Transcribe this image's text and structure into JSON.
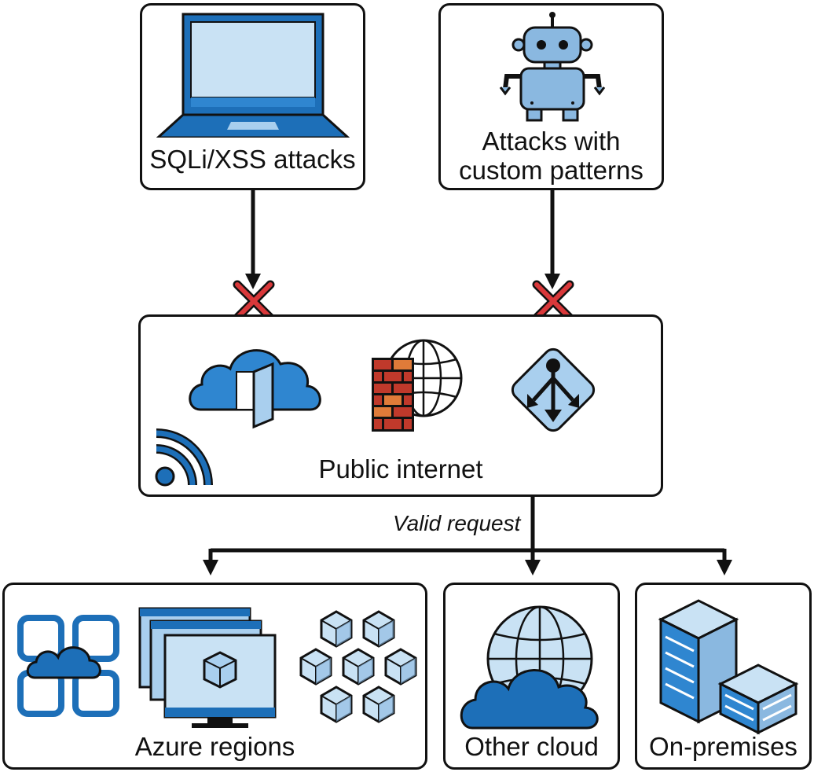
{
  "nodes": {
    "sqli": {
      "label": "SQLi/XSS attacks"
    },
    "custom": {
      "label_line1": "Attacks with",
      "label_line2": "custom patterns"
    },
    "internet": {
      "label": "Public internet"
    },
    "azure": {
      "label": "Azure regions"
    },
    "other_cloud": {
      "label": "Other cloud"
    },
    "on_prem": {
      "label": "On-premises"
    }
  },
  "edges": {
    "valid_request": "Valid request"
  },
  "colors": {
    "blue_dark": "#1d6fb8",
    "blue_mid": "#2f86d0",
    "blue_light": "#c9e2f4",
    "blue_pale": "#a9cfee",
    "brick": "#c0392b",
    "brick_light": "#e07b39",
    "block_red": "#d9383a",
    "stroke": "#111111"
  },
  "icons": [
    "laptop-icon",
    "robot-icon",
    "cloud-frontdoor-icon",
    "firewall-globe-icon",
    "traffic-router-icon",
    "rss-icon",
    "cloud-grid-icon",
    "monitors-icon",
    "cubes-cluster-icon",
    "globe-cloud-icon",
    "building-icon",
    "blocked-x-icon"
  ]
}
